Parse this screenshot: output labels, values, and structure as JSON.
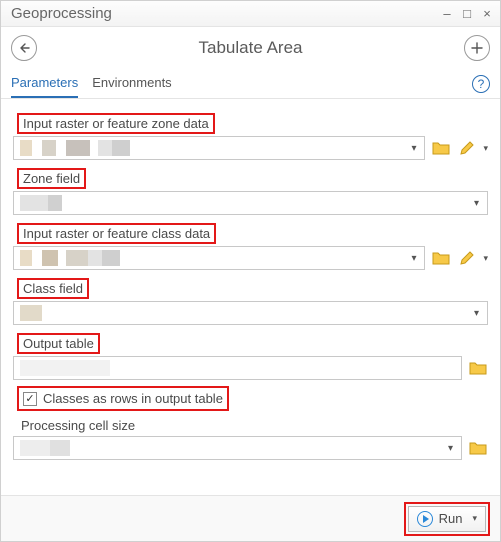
{
  "window": {
    "title": "Geoprocessing"
  },
  "header": {
    "tool_title": "Tabulate Area"
  },
  "tabs": {
    "parameters": "Parameters",
    "environments": "Environments"
  },
  "fields": {
    "input_zone": {
      "label": "Input raster or feature zone data"
    },
    "zone_field": {
      "label": "Zone field"
    },
    "input_class": {
      "label": "Input raster or feature class data"
    },
    "class_field": {
      "label": "Class field"
    },
    "output_table": {
      "label": "Output table"
    },
    "classes_rows": {
      "label": "Classes as rows in output table",
      "checked": true
    },
    "cell_size": {
      "label": "Processing cell size"
    }
  },
  "footer": {
    "run": "Run"
  },
  "icons": {
    "back": "back-icon",
    "add": "add-icon",
    "help": "?",
    "folder": "folder-icon",
    "pencil": "pencil-icon",
    "chev": "▾",
    "check": "✓",
    "min": "–",
    "max": "□",
    "close": "×"
  }
}
